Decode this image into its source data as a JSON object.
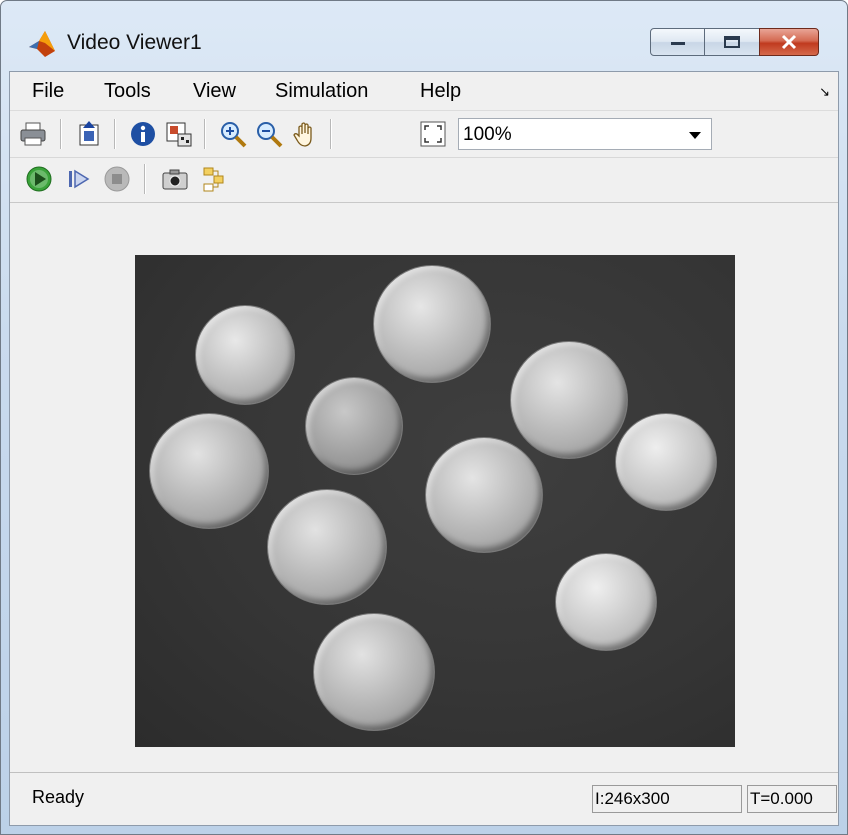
{
  "window": {
    "title": "Video Viewer1"
  },
  "menubar": {
    "items": [
      "File",
      "Tools",
      "View",
      "Simulation",
      "Help"
    ]
  },
  "toolbar": {
    "zoom_value": "100%",
    "icons_row1": [
      "print-icon",
      "open-icon",
      "info-icon",
      "colormap-icon",
      "zoom-in-icon",
      "zoom-out-icon",
      "pan-hand-icon",
      "fit-to-view-icon"
    ],
    "icons_row2": [
      "play-icon",
      "step-forward-icon",
      "stop-icon",
      "snapshot-icon",
      "highlight-block-icon"
    ]
  },
  "image": {
    "description_icon": "coins-image"
  },
  "status": {
    "text": "Ready",
    "size": "I:246x300",
    "time": "T=0.000"
  },
  "colors": {
    "titlebar": "#cadbee",
    "close": "#c03a1f",
    "client": "#f0f0f0",
    "image_bg": "#353535"
  }
}
